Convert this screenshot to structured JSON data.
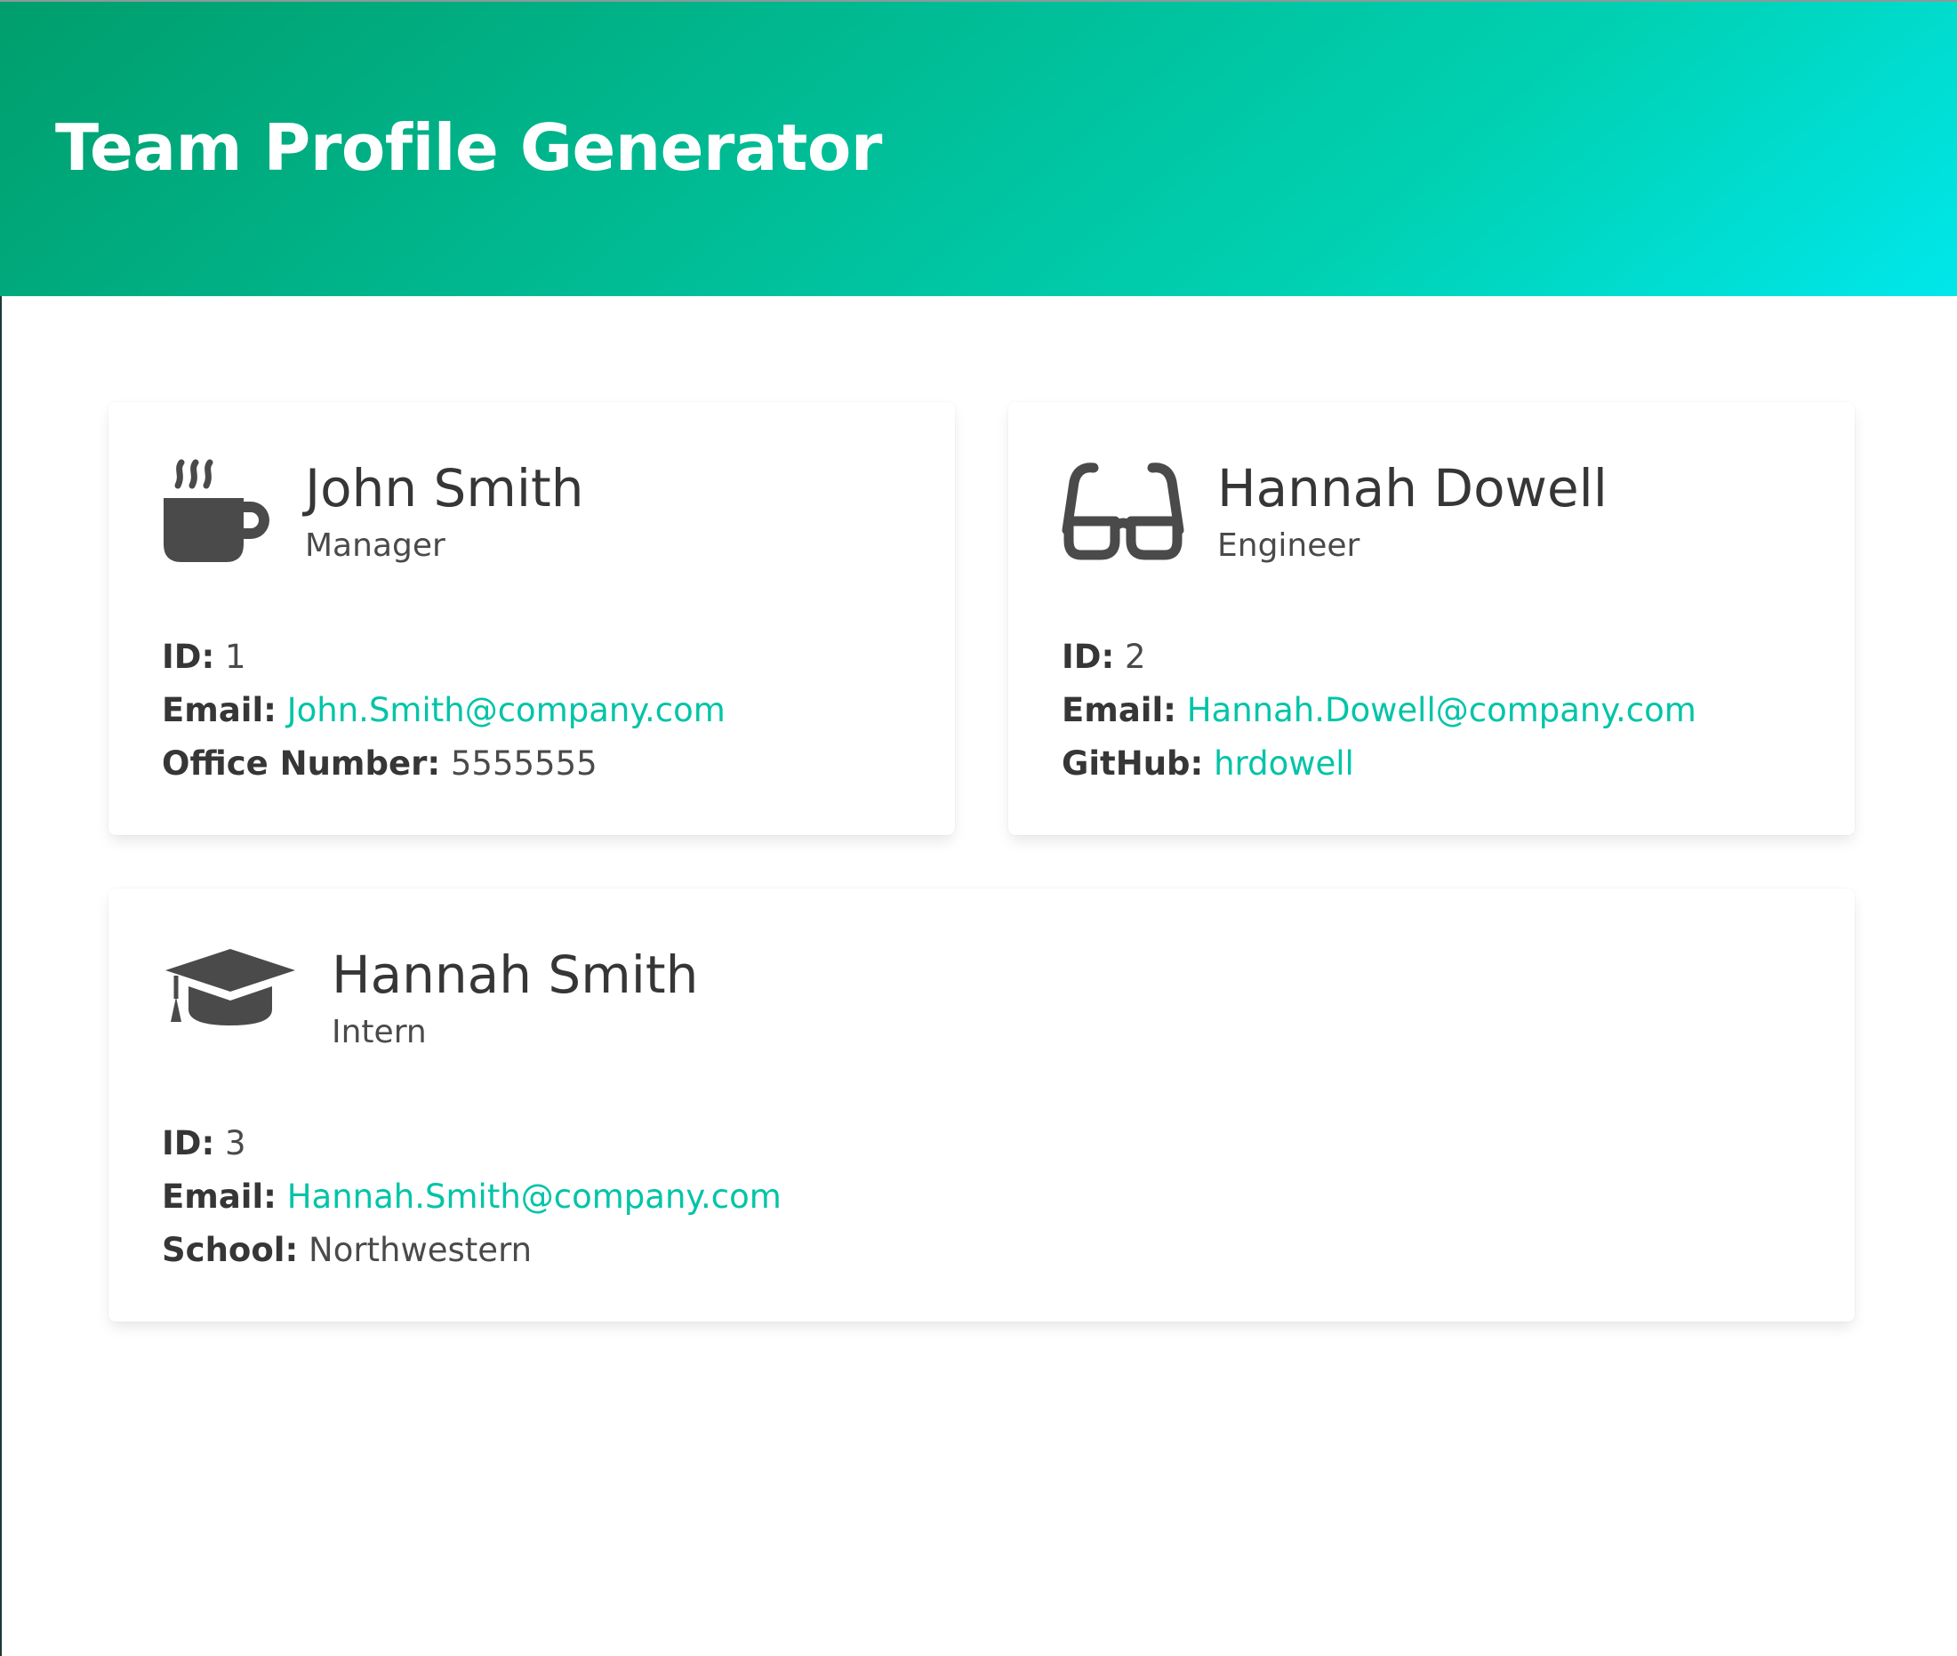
{
  "hero": {
    "title": "Team Profile Generator",
    "gradient_colors": [
      "#009e6c",
      "#00d1b2",
      "#00e7eb"
    ]
  },
  "colors": {
    "link": "#00c4a7",
    "text": "#363636",
    "icon": "#4a4a4a"
  },
  "cards": [
    {
      "icon": "coffee-icon",
      "name": "John Smith",
      "role": "Manager",
      "id_label": "ID:",
      "id": "1",
      "email_label": "Email:",
      "email": "John.Smith@company.com",
      "extra_label": "Office Number:",
      "extra_value": "5555555"
    },
    {
      "icon": "glasses-icon",
      "name": "Hannah Dowell",
      "role": "Engineer",
      "id_label": "ID:",
      "id": "2",
      "email_label": "Email:",
      "email": "Hannah.Dowell@company.com",
      "extra_label": "GitHub:",
      "extra_value": "hrdowell"
    },
    {
      "icon": "graduation-cap-icon",
      "name": "Hannah Smith",
      "role": "Intern",
      "id_label": "ID:",
      "id": "3",
      "email_label": "Email:",
      "email": "Hannah.Smith@company.com",
      "extra_label": "School:",
      "extra_value": "Northwestern"
    }
  ]
}
